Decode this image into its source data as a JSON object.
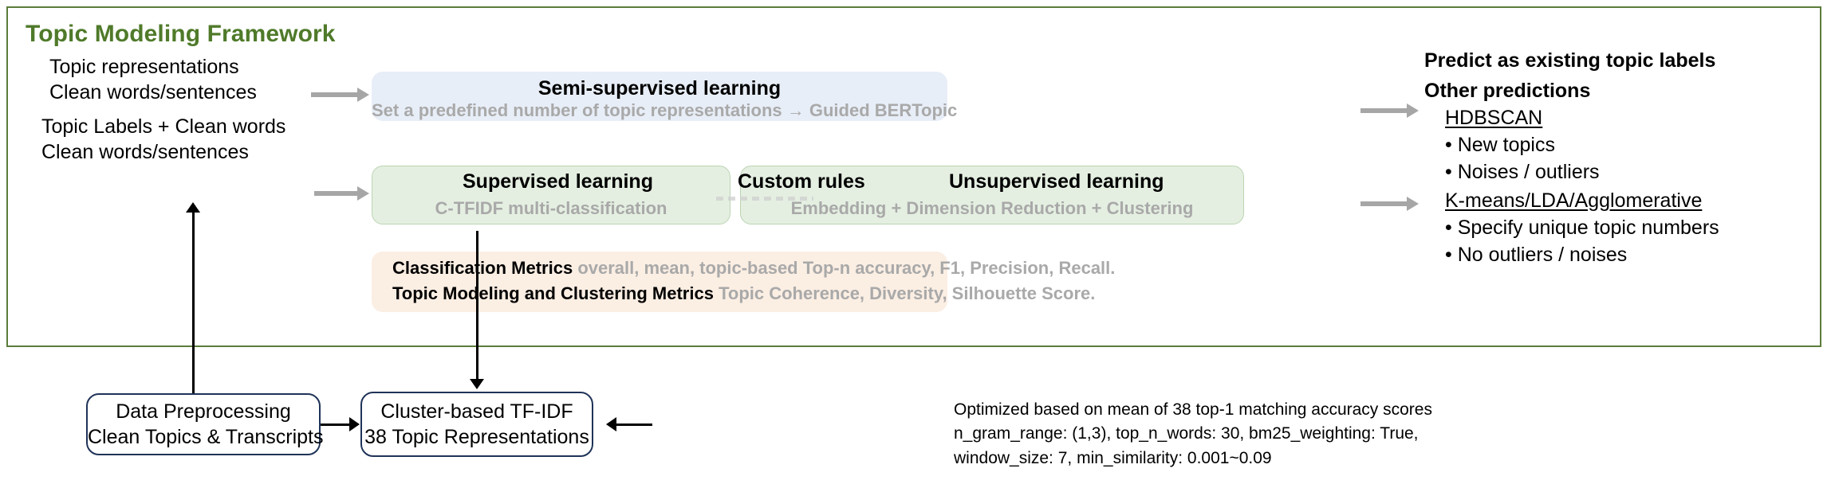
{
  "framework": {
    "title": "Topic Modeling Framework",
    "border_color": "#5b7c3a",
    "title_color": "#4f7a2a"
  },
  "inputs": [
    {
      "line1": "Topic representations",
      "line2": "Clean words/sentences"
    },
    {
      "line1": "Topic Labels + Clean words",
      "line2": "Clean words/sentences"
    }
  ],
  "pipeline": {
    "semi_supervised": {
      "title": "Semi-supervised learning",
      "subtitle": "Set a predefined number of topic representations  →  Guided BERTopic",
      "bg": "#e8eef7"
    },
    "supervised": {
      "title": "Supervised learning",
      "subtitle": "C-TFIDF multi-classification",
      "bg": "#e4efe1"
    },
    "custom_rules": {
      "title": "Custom rules"
    },
    "unsupervised": {
      "title": "Unsupervised learning",
      "subtitle": "Embedding + Dimension Reduction  + Clustering",
      "bg": "#e4efe1"
    },
    "metrics": {
      "bg": "#fbeee3",
      "rows": [
        {
          "strong": "Classification Metrics",
          "light": "overall, mean, topic-based Top-n accuracy, F1, Precision, Recall."
        },
        {
          "strong": "Topic Modeling and Clustering Metrics",
          "light": "Topic Coherence, Diversity, Silhouette Score."
        }
      ]
    }
  },
  "outputs": {
    "predict_existing": "Predict as existing topic labels",
    "other_predictions": "Other predictions",
    "groups": [
      {
        "name": "HDBSCAN",
        "items": [
          "• New topics",
          "• Noises / outliers"
        ]
      },
      {
        "name": "K-means/LDA/Agglomerative",
        "items": [
          "• Specify unique topic numbers",
          "• No outliers / noises"
        ]
      }
    ]
  },
  "bottom": {
    "preprocessing": {
      "line1": "Data Preprocessing",
      "line2": "Clean Topics & Transcripts"
    },
    "ctfidf": {
      "line1": "Cluster-based TF-IDF",
      "line2": "38 Topic Representations"
    },
    "notes": [
      "Optimized based on mean of 38 top-1 matching accuracy scores",
      "n_gram_range: (1,3), top_n_words: 30, bm25_weighting: True,",
      "window_size: 7, min_similarity: 0.001~0.09"
    ]
  }
}
